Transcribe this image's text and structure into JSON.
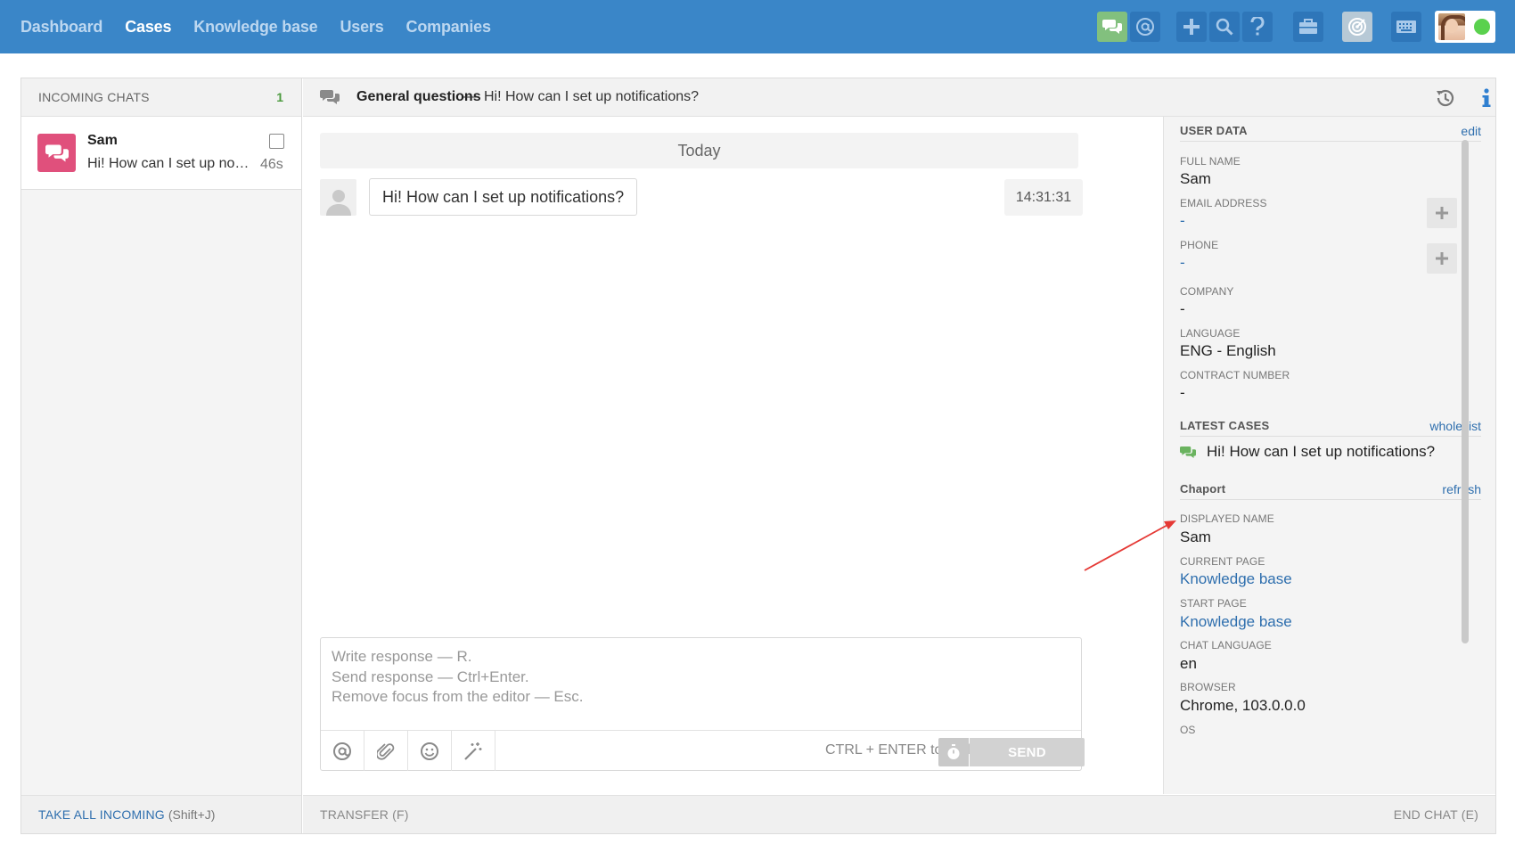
{
  "nav": {
    "items": [
      {
        "label": "Dashboard",
        "active": false
      },
      {
        "label": "Cases",
        "active": true
      },
      {
        "label": "Knowledge base",
        "active": false
      },
      {
        "label": "Users",
        "active": false
      },
      {
        "label": "Companies",
        "active": false
      }
    ],
    "icons": [
      "chats-icon",
      "at-icon",
      "plus-icon",
      "search-icon",
      "help-icon",
      "briefcase-icon",
      "target-icon",
      "keyboard-icon"
    ],
    "status_color": "#5ad14e",
    "brand_color": "#3a86c8"
  },
  "incoming": {
    "title": "INCOMING CHATS",
    "count": "1",
    "chats": [
      {
        "name": "Sam",
        "message": "Hi! How can I set up notifications?",
        "age": "46s"
      }
    ],
    "take_all": "TAKE ALL INCOMING",
    "take_all_shortcut": "(Shift+J)"
  },
  "conversation": {
    "topic": "General questions",
    "separator": "—",
    "subject": "Hi! How can I set up notifications?",
    "day_label": "Today",
    "messages": [
      {
        "text": "Hi! How can I set up notifications?",
        "time": "14:31:31"
      }
    ]
  },
  "editor": {
    "placeholder_lines": [
      "Write response — R.",
      "Send response — Ctrl+Enter.",
      "Remove focus from the editor — Esc."
    ],
    "hint": "CTRL + ENTER to reply",
    "send_label": "SEND"
  },
  "footer": {
    "transfer": "TRANSFER (F)",
    "end_chat": "END CHAT (E)"
  },
  "user_data": {
    "section": "USER DATA",
    "edit": "edit",
    "fields": [
      {
        "label": "FULL NAME",
        "value": "Sam"
      },
      {
        "label": "EMAIL ADDRESS",
        "value": "-"
      },
      {
        "label": "PHONE",
        "value": "-"
      },
      {
        "label": "COMPANY",
        "value": "-"
      },
      {
        "label": "LANGUAGE",
        "value": "ENG - English"
      },
      {
        "label": "CONTRACT NUMBER",
        "value": "-"
      }
    ]
  },
  "latest_cases": {
    "section": "LATEST CASES",
    "link": "whole list",
    "items": [
      "Hi! How can I set up notifications?"
    ]
  },
  "chaport": {
    "section": "Chaport",
    "link": "refresh",
    "fields": [
      {
        "label": "DISPLAYED NAME",
        "value": "Sam"
      },
      {
        "label": "CURRENT PAGE",
        "value": "Knowledge base"
      },
      {
        "label": "START PAGE",
        "value": "Knowledge base"
      },
      {
        "label": "CHAT LANGUAGE",
        "value": "en"
      },
      {
        "label": "BROWSER",
        "value": "Chrome, 103.0.0.0"
      },
      {
        "label": "OS",
        "value": ""
      }
    ]
  }
}
